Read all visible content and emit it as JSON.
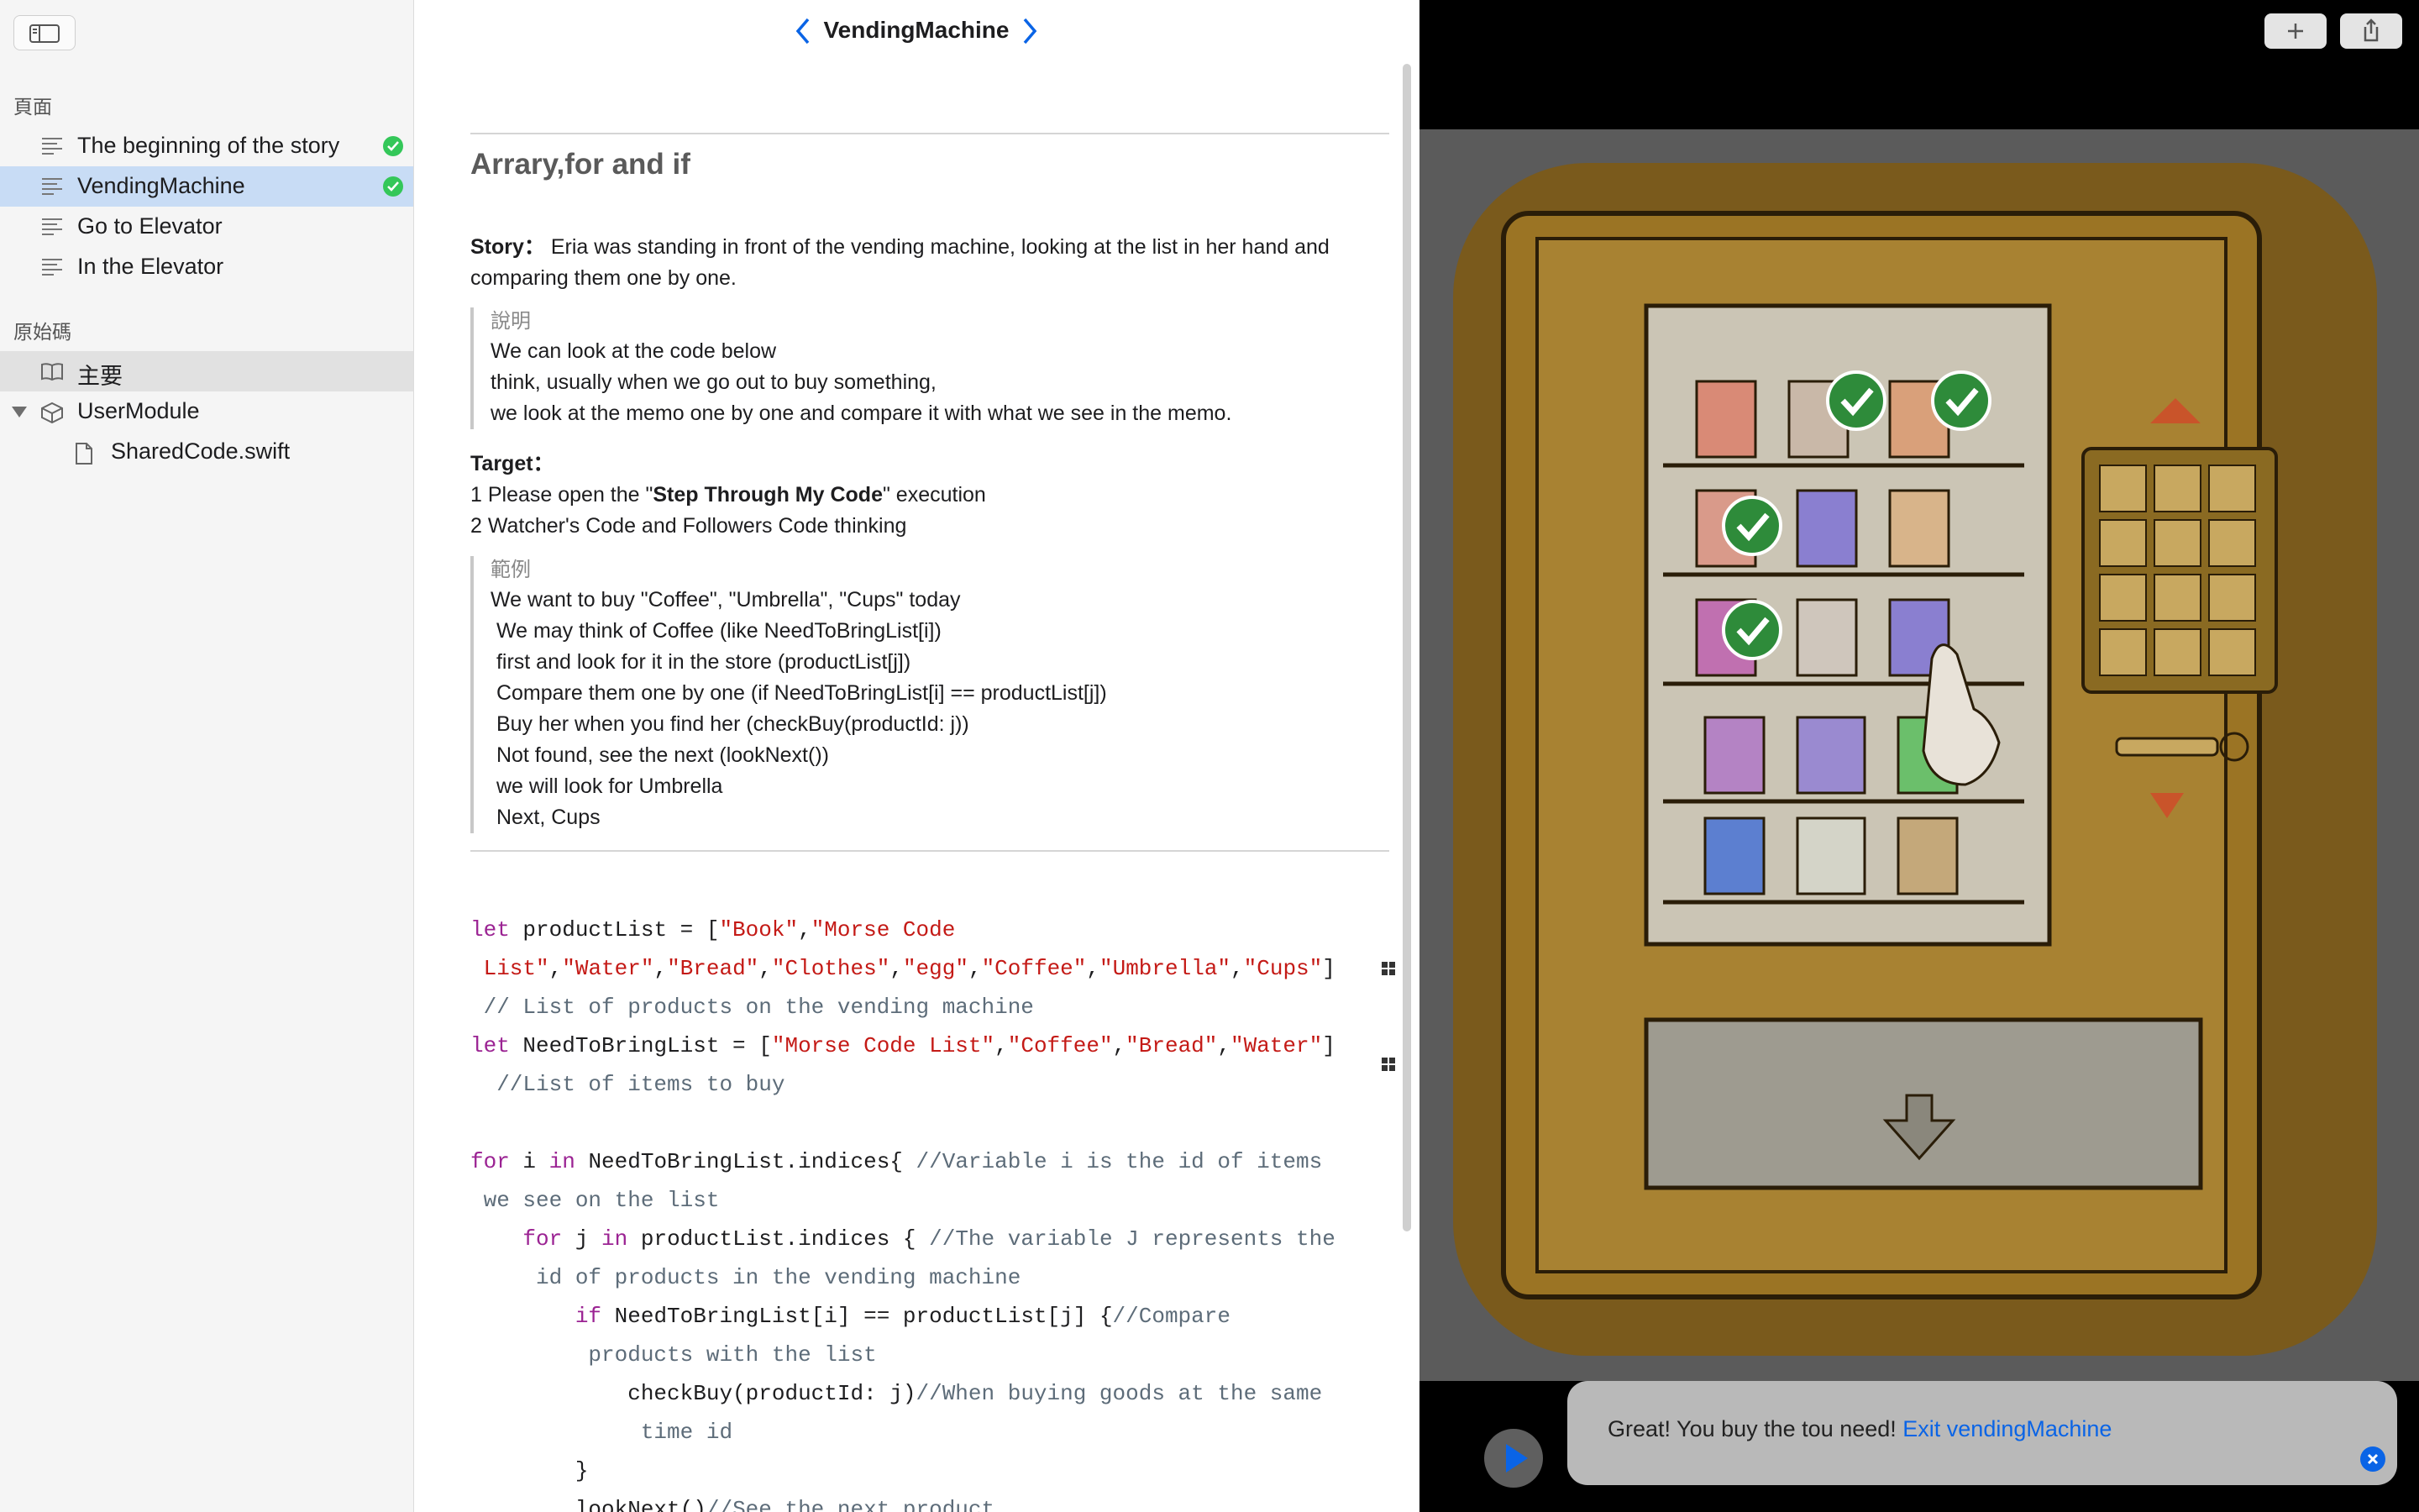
{
  "sidebar": {
    "section_pages": "頁面",
    "pages": [
      {
        "label": "The beginning of the story",
        "completed": true
      },
      {
        "label": "VendingMachine",
        "completed": true,
        "selected": true
      },
      {
        "label": "Go to Elevator",
        "completed": false
      },
      {
        "label": "In the Elevator",
        "completed": false
      }
    ],
    "section_source": "原始碼",
    "sources": [
      {
        "label": "主要",
        "icon": "book-icon"
      },
      {
        "label": "UserModule",
        "icon": "module-cube-icon"
      },
      {
        "label": "SharedCode.swift",
        "icon": "document-icon"
      }
    ]
  },
  "nav": {
    "title": "VendingMachine"
  },
  "article": {
    "heading": "Arrary,for and if",
    "story_label": "Story：",
    "story_text": " Eria was standing in front of the vending machine, looking at the list in her hand and",
    "story_text2": "comparing them one by one.",
    "note_title": "說明",
    "note_lines": [
      "We can look at the code below",
      "think, usually when we go out to buy something,",
      "we look at the memo one by one and compare it with what we see in the memo."
    ],
    "target_label": "Target：",
    "target_line1_a": "1 Please open the \"",
    "target_line1_b": "Step Through My Code",
    "target_line1_c": "\" execution",
    "target_line2": "2 Watcher's Code and Followers Code thinking",
    "example_title": "範例",
    "example_lines": [
      "We want to buy \"Coffee\", \"Umbrella\", \"Cups\" today",
      " We may think of Coffee (like NeedToBringList[i])",
      " first and look for it in the store (productList[j])",
      " Compare them one by one (if NeedToBringList[i] == productList[j])",
      " Buy her when you find her (checkBuy(productId: j))",
      " Not found, see the next (lookNext())",
      " we will look for Umbrella",
      " Next, Cups"
    ]
  },
  "code": {
    "l1_kw": "let",
    "l1_a": " productList = [",
    "l1_s1": "\"Book\"",
    "l1_c1": ",",
    "l1_s2": "\"Morse Code",
    "l2_s1": " List\"",
    "l2_c1": ",",
    "l2_s2": "\"Water\"",
    "l2_c2": ",",
    "l2_s3": "\"Bread\"",
    "l2_c3": ",",
    "l2_s4": "\"Clothes\"",
    "l2_c4": ",",
    "l2_s5": "\"egg\"",
    "l2_c5": ",",
    "l2_s6": "\"Coffee\"",
    "l2_c6": ",",
    "l2_s7": "\"Umbrella\"",
    "l2_c7": ",",
    "l2_s8": "\"Cups\"",
    "l2_e": "]",
    "l3_cm": " // List of products on the vending machine",
    "l4_kw": "let",
    "l4_a": " NeedToBringList = [",
    "l4_s1": "\"Morse Code List\"",
    "l4_c1": ",",
    "l4_s2": "\"Coffee\"",
    "l4_c2": ",",
    "l4_s3": "\"Bread\"",
    "l4_c3": ",",
    "l4_s4": "\"Water\"",
    "l4_e": "]",
    "l5_cm": "  //List of items to buy",
    "l6_kw1": "for",
    "l6_a": " i ",
    "l6_kw2": "in",
    "l6_b": " NeedToBringList.indices{ ",
    "l6_cm": "//Variable i is the id of items",
    "l7_cm": " we see on the list",
    "l8_ind": "    ",
    "l8_kw1": "for",
    "l8_a": " j ",
    "l8_kw2": "in",
    "l8_b": " productList.indices { ",
    "l8_cm": "//The variable J represents the",
    "l9_cm": "     id of products in the vending machine",
    "l10_ind": "        ",
    "l10_kw": "if",
    "l10_a": " NeedToBringList[i] == productList[j] {",
    "l10_cm": "//Compare",
    "l11_cm": "         products with the list",
    "l12_a": "            checkBuy(productId: j)",
    "l12_cm": "//When buying goods at the same",
    "l13_cm": "             time id",
    "l14_a": "        }",
    "l15_a": "        lookNext()",
    "l15_cm": "//See the next product"
  },
  "live": {
    "toast_text": "Great! You buy the tou need! ",
    "toast_link": "Exit vendingMachine"
  },
  "colors": {
    "accent": "#0a64e6",
    "check": "#34c759",
    "keyword": "#9b2393",
    "string": "#c41a16",
    "comment": "#5d6c79"
  }
}
